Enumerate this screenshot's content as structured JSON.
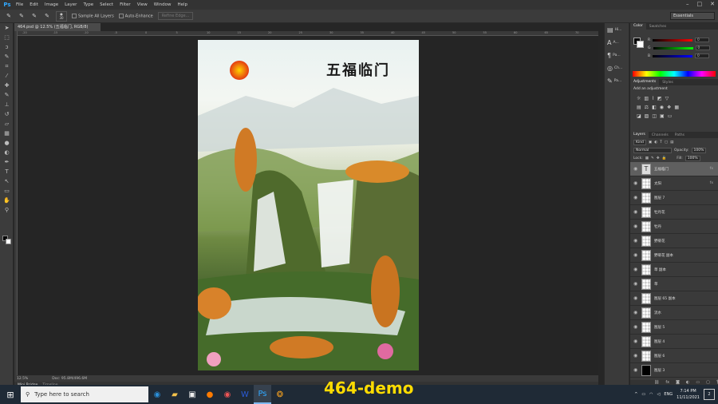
{
  "app": {
    "logo": "Ps"
  },
  "menu": [
    "File",
    "Edit",
    "Image",
    "Layer",
    "Type",
    "Select",
    "Filter",
    "View",
    "Window",
    "Help"
  ],
  "window_controls": [
    "–",
    "□",
    "✕"
  ],
  "options_bar": {
    "brush_size": "30",
    "sample_all_layers": "Sample All Layers",
    "auto_enhance": "Auto-Enhance",
    "refine_edge": "Refine Edge...",
    "workspace": "Essentials"
  },
  "document": {
    "tab_title": "464.psd @ 12.5% (五福临门, RGB/8)",
    "canvas_title": "五福临门",
    "ruler_numbers": [
      "-20",
      "-15",
      "-10",
      "-5",
      "0",
      "5",
      "10",
      "15",
      "20",
      "25",
      "30",
      "35",
      "40",
      "45",
      "50",
      "55",
      "60",
      "65",
      "70"
    ]
  },
  "status": {
    "zoom": "12.5%",
    "doc_size": "Doc: 95.8M/496.6M"
  },
  "mini_bridge": {
    "tabs": [
      "Mini Bridge",
      "Timeline"
    ]
  },
  "side_panel_buttons": [
    {
      "icon": "history-icon",
      "label": "Hi..."
    },
    {
      "icon": "character-icon",
      "label": "A..."
    },
    {
      "icon": "paragraph-icon",
      "label": "Pa..."
    },
    {
      "icon": "channels-icon",
      "label": "Ch..."
    },
    {
      "icon": "paths-icon",
      "label": "Pa..."
    }
  ],
  "color_panel": {
    "tabs": [
      "Color",
      "Swatches"
    ],
    "channels": [
      {
        "label": "R",
        "value": "0"
      },
      {
        "label": "G",
        "value": "0"
      },
      {
        "label": "B",
        "value": "0"
      }
    ]
  },
  "adjustments_panel": {
    "tabs": [
      "Adjustments",
      "Styles"
    ],
    "add_label": "Add an adjustment"
  },
  "layers_panel": {
    "tabs": [
      "Layers",
      "Channels",
      "Paths"
    ],
    "kind": "Kind",
    "blend_mode": "Normal",
    "opacity_label": "Opacity:",
    "opacity": "100%",
    "lock_label": "Lock:",
    "fill_label": "Fill:",
    "fill": "100%",
    "layers": [
      {
        "name": "五福临门",
        "type": "text",
        "selected": true,
        "fx": "fx"
      },
      {
        "name": "太阳",
        "type": "pixel",
        "selected": false,
        "fx": "fx"
      },
      {
        "name": "图层 7",
        "type": "pixel",
        "selected": false,
        "fx": ""
      },
      {
        "name": "牡丹花",
        "type": "pixel",
        "selected": false,
        "fx": ""
      },
      {
        "name": "牡丹",
        "type": "pixel",
        "selected": false,
        "fx": ""
      },
      {
        "name": "野菊花",
        "type": "pixel",
        "selected": false,
        "fx": ""
      },
      {
        "name": "野菊花 副本",
        "type": "pixel",
        "selected": false,
        "fx": ""
      },
      {
        "name": "草 副本",
        "type": "pixel",
        "selected": false,
        "fx": ""
      },
      {
        "name": "草",
        "type": "pixel",
        "selected": false,
        "fx": ""
      },
      {
        "name": "图层 65 副本",
        "type": "pixel",
        "selected": false,
        "fx": ""
      },
      {
        "name": "流水",
        "type": "pixel",
        "selected": false,
        "fx": ""
      },
      {
        "name": "图层 5",
        "type": "pixel",
        "selected": false,
        "fx": ""
      },
      {
        "name": "图层 4",
        "type": "pixel",
        "selected": false,
        "fx": ""
      },
      {
        "name": "图层 6",
        "type": "pixel",
        "selected": false,
        "fx": ""
      },
      {
        "name": "图层 3",
        "type": "mask",
        "selected": false,
        "fx": ""
      }
    ]
  },
  "taskbar": {
    "search_placeholder": "Type here to search",
    "tray_lang": "ENG",
    "time": "7:14 PM",
    "date": "11/11/2021",
    "notification_count": "2"
  },
  "overlay_label": "464-demo"
}
